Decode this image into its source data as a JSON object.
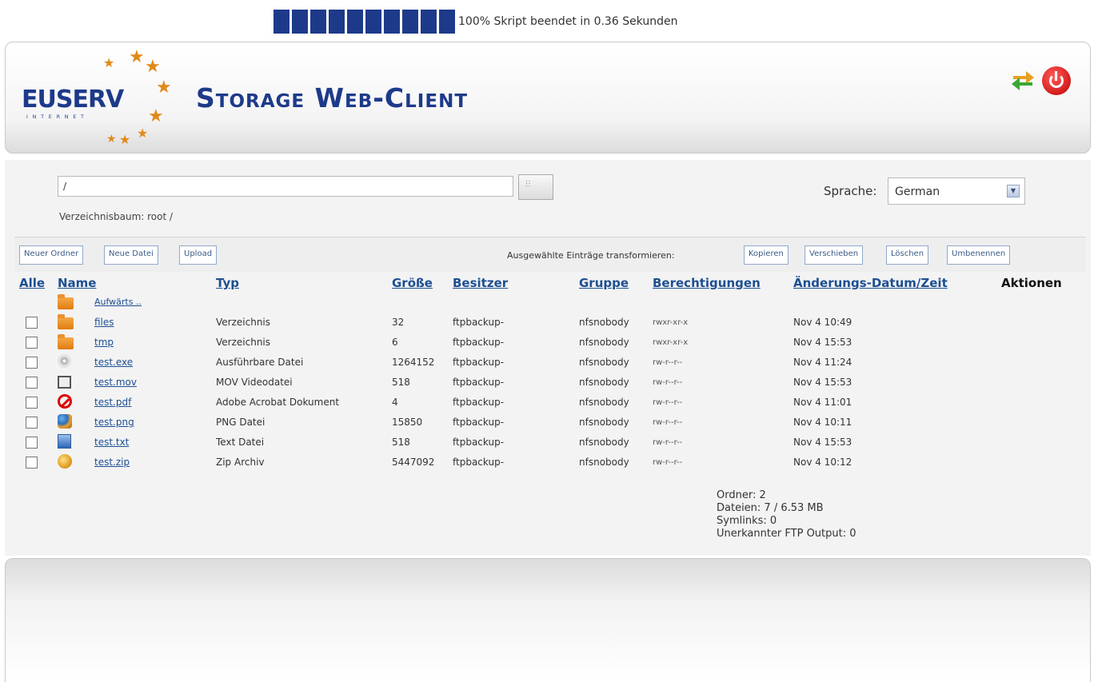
{
  "progress": {
    "percent": 100,
    "blocks": 10,
    "text": "100% Skript beendet in 0.36 Sekunden",
    "color": "#1d3a8a"
  },
  "header": {
    "logo_text": "EUSERV",
    "logo_sub": "INTERNET",
    "title": "Storage Web-Client",
    "icons": [
      "refresh-icon",
      "power-icon"
    ]
  },
  "path": {
    "value": "/",
    "dirtree": "Verzeichnisbaum: root /"
  },
  "language": {
    "label": "Sprache:",
    "selected": "German"
  },
  "toolbar": {
    "new_folder": "Neuer Ordner",
    "new_file": "Neue Datei",
    "upload": "Upload",
    "transform_label": "Ausgewählte Einträge transformieren:",
    "copy": "Kopieren",
    "move": "Verschieben",
    "delete": "Löschen",
    "rename": "Umbenennen"
  },
  "columns": {
    "all": "Alle",
    "name": "Name",
    "type": "Typ",
    "size": "Größe",
    "owner": "Besitzer",
    "group": "Gruppe",
    "perms": "Berechtigungen",
    "date": "Änderungs-Datum/Zeit",
    "actions": "Aktionen"
  },
  "up_label": "Aufwärts ..",
  "rows": [
    {
      "icon": "folder-icon",
      "name": "files",
      "type": "Verzeichnis",
      "size": "32",
      "owner": "ftpbackup-",
      "group": "nfsnobody",
      "perms": "rwxr-xr-x",
      "date": "Nov 4 10:49"
    },
    {
      "icon": "folder-icon",
      "name": "tmp",
      "type": "Verzeichnis",
      "size": "6",
      "owner": "ftpbackup-",
      "group": "nfsnobody",
      "perms": "rwxr-xr-x",
      "date": "Nov 4 15:53"
    },
    {
      "icon": "disc-icon",
      "name": "test.exe",
      "type": "Ausführbare Datei",
      "size": "1264152",
      "owner": "ftpbackup-",
      "group": "nfsnobody",
      "perms": "rw-r--r--",
      "date": "Nov 4 11:24"
    },
    {
      "icon": "film-icon",
      "name": "test.mov",
      "type": "MOV Videodatei",
      "size": "518",
      "owner": "ftpbackup-",
      "group": "nfsnobody",
      "perms": "rw-r--r--",
      "date": "Nov 4 15:53"
    },
    {
      "icon": "pdf-icon",
      "name": "test.pdf",
      "type": "Adobe Acrobat Dokument",
      "size": "4",
      "owner": "ftpbackup-",
      "group": "nfsnobody",
      "perms": "rw-r--r--",
      "date": "Nov 4 11:01"
    },
    {
      "icon": "png-icon",
      "name": "test.png",
      "type": "PNG Datei",
      "size": "15850",
      "owner": "ftpbackup-",
      "group": "nfsnobody",
      "perms": "rw-r--r--",
      "date": "Nov 4 10:11"
    },
    {
      "icon": "txt-icon",
      "name": "test.txt",
      "type": "Text Datei",
      "size": "518",
      "owner": "ftpbackup-",
      "group": "nfsnobody",
      "perms": "rw-r--r--",
      "date": "Nov 4 15:53"
    },
    {
      "icon": "zip-icon",
      "name": "test.zip",
      "type": "Zip Archiv",
      "size": "5447092",
      "owner": "ftpbackup-",
      "group": "nfsnobody",
      "perms": "rw-r--r--",
      "date": "Nov 4 10:12"
    }
  ],
  "summary": {
    "folders": "Ordner: 2",
    "files": "Dateien: 7 / 6.53 MB",
    "symlinks": "Symlinks: 0",
    "unknown": "Unerkannter FTP Output: 0"
  }
}
